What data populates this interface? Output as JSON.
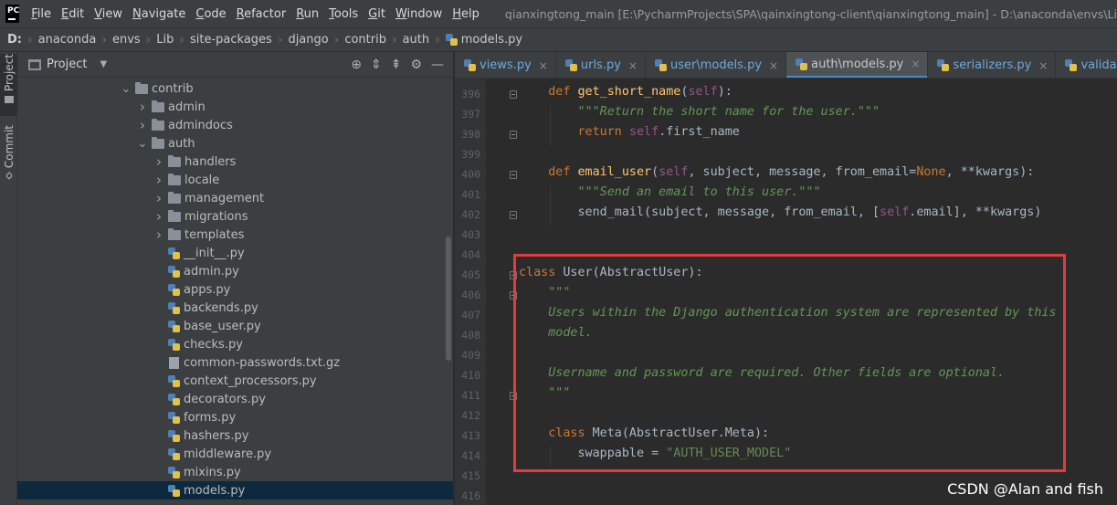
{
  "menu": {
    "items": [
      {
        "mnemonic": "F",
        "rest": "ile"
      },
      {
        "mnemonic": "E",
        "rest": "dit"
      },
      {
        "mnemonic": "V",
        "rest": "iew"
      },
      {
        "mnemonic": "N",
        "rest": "avigate"
      },
      {
        "mnemonic": "C",
        "rest": "ode"
      },
      {
        "mnemonic": "R",
        "rest": "efactor"
      },
      {
        "mnemonic": "R",
        "rest": "un"
      },
      {
        "mnemonic": "T",
        "rest": "ools"
      },
      {
        "mnemonic": "G",
        "rest": "it"
      },
      {
        "mnemonic": "W",
        "rest": "indow"
      },
      {
        "mnemonic": "H",
        "rest": "elp"
      }
    ],
    "window_title": "qianxingtong_main [E:\\PycharmProjects\\SPA\\qainxingtong-client\\qianxingtong_main] - D:\\anaconda\\envs\\Lib\\site-pac"
  },
  "app_logo": "PC",
  "breadcrumb": [
    "D:",
    "anaconda",
    "envs",
    "Lib",
    "site-packages",
    "django",
    "contrib",
    "auth",
    "models.py"
  ],
  "toolstrip": {
    "project_label": "Project",
    "commit_label": "Commit"
  },
  "project_panel": {
    "title": "Project",
    "tree": [
      {
        "name": "contrib",
        "type": "folder",
        "depth": 0,
        "expanded": true
      },
      {
        "name": "admin",
        "type": "folder",
        "depth": 1,
        "expanded": false
      },
      {
        "name": "admindocs",
        "type": "folder",
        "depth": 1,
        "expanded": false
      },
      {
        "name": "auth",
        "type": "folder",
        "depth": 1,
        "expanded": true
      },
      {
        "name": "handlers",
        "type": "folder",
        "depth": 2,
        "expanded": false
      },
      {
        "name": "locale",
        "type": "folder",
        "depth": 2,
        "expanded": false
      },
      {
        "name": "management",
        "type": "folder",
        "depth": 2,
        "expanded": false
      },
      {
        "name": "migrations",
        "type": "folder",
        "depth": 2,
        "expanded": false
      },
      {
        "name": "templates",
        "type": "folder",
        "depth": 2,
        "expanded": false
      },
      {
        "name": "__init__.py",
        "type": "py",
        "depth": 2
      },
      {
        "name": "admin.py",
        "type": "py",
        "depth": 2
      },
      {
        "name": "apps.py",
        "type": "py",
        "depth": 2
      },
      {
        "name": "backends.py",
        "type": "py",
        "depth": 2
      },
      {
        "name": "base_user.py",
        "type": "py",
        "depth": 2
      },
      {
        "name": "checks.py",
        "type": "py",
        "depth": 2
      },
      {
        "name": "common-passwords.txt.gz",
        "type": "file",
        "depth": 2
      },
      {
        "name": "context_processors.py",
        "type": "py",
        "depth": 2
      },
      {
        "name": "decorators.py",
        "type": "py",
        "depth": 2
      },
      {
        "name": "forms.py",
        "type": "py",
        "depth": 2
      },
      {
        "name": "hashers.py",
        "type": "py",
        "depth": 2
      },
      {
        "name": "middleware.py",
        "type": "py",
        "depth": 2
      },
      {
        "name": "mixins.py",
        "type": "py",
        "depth": 2
      },
      {
        "name": "models.py",
        "type": "py",
        "depth": 2,
        "selected": true
      }
    ]
  },
  "tabs": [
    {
      "label": "views.py",
      "active": false
    },
    {
      "label": "urls.py",
      "active": false
    },
    {
      "label": "user\\models.py",
      "active": false
    },
    {
      "label": "auth\\models.py",
      "active": true
    },
    {
      "label": "serializers.py",
      "active": false
    },
    {
      "label": "validator.py",
      "active": false
    }
  ],
  "tab_close_glyph": "×",
  "editor": {
    "lines": [
      {
        "n": "396",
        "segs": [
          [
            "    ",
            ""
          ],
          [
            "def ",
            "kw"
          ],
          [
            "get_short_name",
            "fn"
          ],
          [
            "(",
            ""
          ],
          [
            "self",
            "slf"
          ],
          [
            "):",
            ""
          ]
        ]
      },
      {
        "n": "397",
        "segs": [
          [
            "        ",
            ""
          ],
          [
            "\"\"\"Return the short name for the user.\"\"\"",
            "doc"
          ]
        ]
      },
      {
        "n": "398",
        "segs": [
          [
            "        ",
            ""
          ],
          [
            "return ",
            "kw"
          ],
          [
            "self",
            "slf"
          ],
          [
            ".first_name",
            ""
          ]
        ]
      },
      {
        "n": "399",
        "segs": []
      },
      {
        "n": "400",
        "segs": [
          [
            "    ",
            ""
          ],
          [
            "def ",
            "kw"
          ],
          [
            "email_user",
            "fn"
          ],
          [
            "(",
            ""
          ],
          [
            "self",
            "slf"
          ],
          [
            ", subject, message, from_email=",
            ""
          ],
          [
            "None",
            "kw"
          ],
          [
            ", **kwargs):",
            ""
          ]
        ]
      },
      {
        "n": "401",
        "segs": [
          [
            "        ",
            ""
          ],
          [
            "\"\"\"Send an email to this user.\"\"\"",
            "doc"
          ]
        ]
      },
      {
        "n": "402",
        "segs": [
          [
            "        ",
            ""
          ],
          [
            "send_mail(subject, message, from_email, [",
            ""
          ],
          [
            "self",
            "slf"
          ],
          [
            ".email], **kwargs)",
            ""
          ]
        ]
      },
      {
        "n": "403",
        "segs": []
      },
      {
        "n": "404",
        "segs": []
      },
      {
        "n": "405",
        "segs": [
          [
            "class ",
            "kw"
          ],
          [
            "User(AbstractUser):",
            ""
          ]
        ]
      },
      {
        "n": "406",
        "segs": [
          [
            "    ",
            ""
          ],
          [
            "\"\"\"",
            "doc"
          ]
        ]
      },
      {
        "n": "407",
        "segs": [
          [
            "    ",
            ""
          ],
          [
            "Users within the Django authentication system are represented by this",
            "doc"
          ]
        ]
      },
      {
        "n": "408",
        "segs": [
          [
            "    ",
            ""
          ],
          [
            "model.",
            "doc"
          ]
        ]
      },
      {
        "n": "409",
        "segs": []
      },
      {
        "n": "410",
        "segs": [
          [
            "    ",
            ""
          ],
          [
            "Username and password are required. Other fields are optional.",
            "doc"
          ]
        ]
      },
      {
        "n": "411",
        "segs": [
          [
            "    ",
            ""
          ],
          [
            "\"\"\"",
            "doc"
          ]
        ]
      },
      {
        "n": "412",
        "segs": []
      },
      {
        "n": "413",
        "segs": [
          [
            "    ",
            ""
          ],
          [
            "class ",
            "kw"
          ],
          [
            "Meta(AbstractUser.Meta):",
            ""
          ]
        ]
      },
      {
        "n": "414",
        "segs": [
          [
            "        ",
            ""
          ],
          [
            "swappable = ",
            ""
          ],
          [
            "\"AUTH_USER_MODEL\"",
            "str"
          ]
        ]
      },
      {
        "n": "415",
        "segs": []
      },
      {
        "n": "416",
        "segs": []
      }
    ]
  },
  "watermark": "CSDN @Alan and fish"
}
